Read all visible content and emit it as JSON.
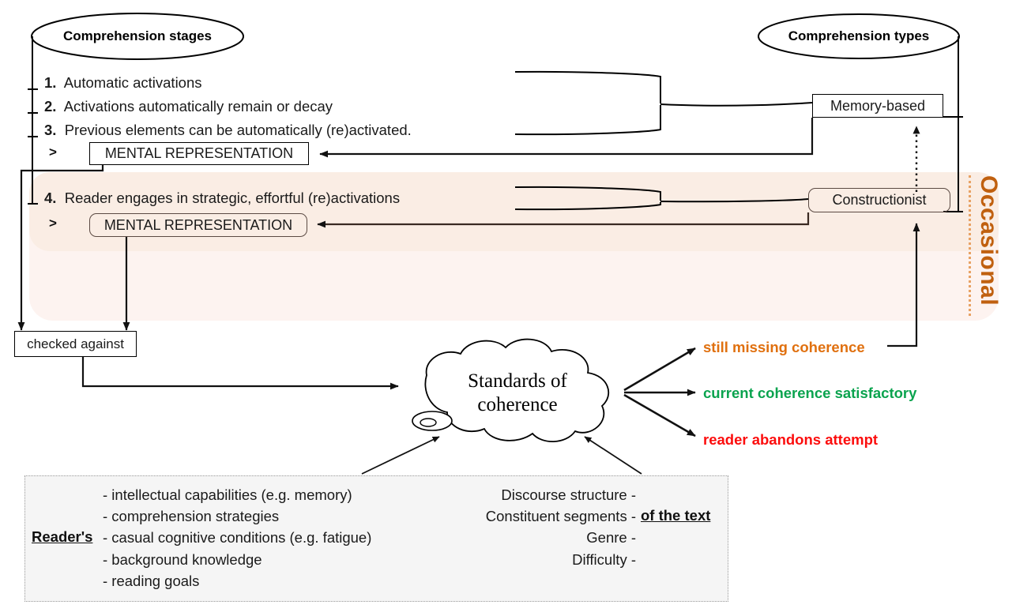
{
  "title_ellipses": {
    "stages": "Comprehension stages",
    "types": "Comprehension types"
  },
  "stages": [
    {
      "num": "1.",
      "text": "Automatic activations"
    },
    {
      "num": "2.",
      "text": "Activations automatically remain or decay"
    },
    {
      "num": "3.",
      "text": "Previous elements can be automatically (re)activated."
    },
    {
      "num": "4.",
      "text": "Reader engages in strategic, effortful (re)activations"
    }
  ],
  "chevron": ">",
  "boxes": {
    "mental_representation_1": "MENTAL REPRESENTATION",
    "mental_representation_2": "MENTAL REPRESENTATION",
    "memory_based": "Memory-based",
    "constructionist": "Constructionist",
    "checked_against": "checked against"
  },
  "occasional_label": "Occasional",
  "cloud": {
    "line1": "Standards of",
    "line2": "coherence"
  },
  "outcomes": [
    {
      "label": "still missing coherence",
      "color": "#e0700f"
    },
    {
      "label": "current coherence satisfactory",
      "color": "#0aa34e"
    },
    {
      "label": "reader abandons attempt",
      "color": "#fc0d0d"
    }
  ],
  "factors": {
    "reader_tag": "Reader's",
    "reader_items": [
      "- intellectual capabilities (e.g. memory)",
      "- comprehension strategies",
      "- casual cognitive conditions (e.g. fatigue)",
      "- background knowledge",
      "- reading goals"
    ],
    "text_tag": "of the text",
    "text_items": [
      "Discourse structure -",
      "Constituent segments -",
      "Genre -",
      "Difficulty -"
    ]
  },
  "colors": {
    "occasional": "#c0600f",
    "band_inner": "#faede4",
    "band_outer": "#fdf3f0",
    "panel_bg": "#f5f5f5",
    "stroke": "#000000"
  }
}
